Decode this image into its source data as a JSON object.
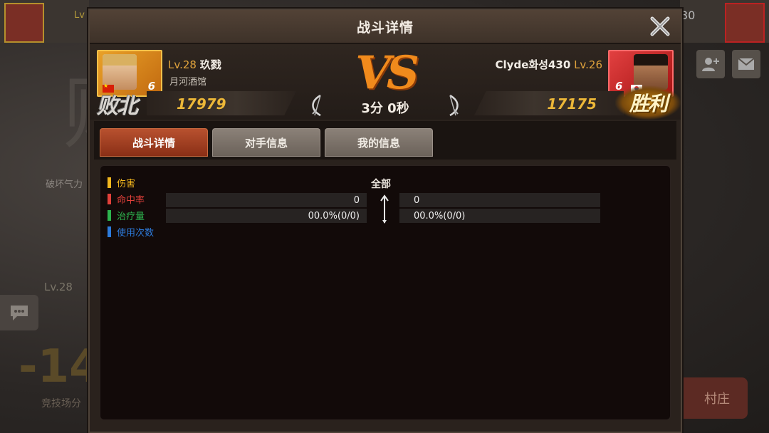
{
  "background": {
    "left_level": "Lv",
    "right_number": "30",
    "big_text": "败",
    "label_energy": "破坏气力",
    "player_level": "Lv.28",
    "score_change": "-14",
    "arena_label": "竞技场分",
    "village_button": "村庄",
    "icons": [
      "chat-icon",
      "add-friend-icon",
      "mail-icon"
    ]
  },
  "dialog": {
    "title": "战斗详情",
    "close_icon": "close-icon"
  },
  "player_left": {
    "level": "Lv.28",
    "name": "玖戮",
    "guild": "月河酒馆",
    "stars": "6",
    "score": "17979",
    "result": "败北",
    "flag": "china-flag-icon"
  },
  "player_right": {
    "name": "Clyde화성430",
    "level": "Lv.26",
    "stars": "6",
    "score": "17175",
    "result": "胜利",
    "flag": "korea-flag-icon"
  },
  "battle": {
    "vs": "VS",
    "duration": "3分 0秒"
  },
  "tabs": [
    {
      "label": "战斗详情",
      "active": true
    },
    {
      "label": "对手信息",
      "active": false
    },
    {
      "label": "我的信息",
      "active": false
    }
  ],
  "legend": [
    {
      "label": "伤害",
      "color": "#f2b61e"
    },
    {
      "label": "命中率",
      "color": "#e2403a"
    },
    {
      "label": "治疗量",
      "color": "#2db44e"
    },
    {
      "label": "使用次数",
      "color": "#2d7bdc"
    }
  ],
  "filter": {
    "label": "全部"
  },
  "stats": {
    "row1": {
      "left": "0",
      "right": "0"
    },
    "row2": {
      "left": "00.0%(0/0)",
      "right": "00.0%(0/0)"
    }
  }
}
